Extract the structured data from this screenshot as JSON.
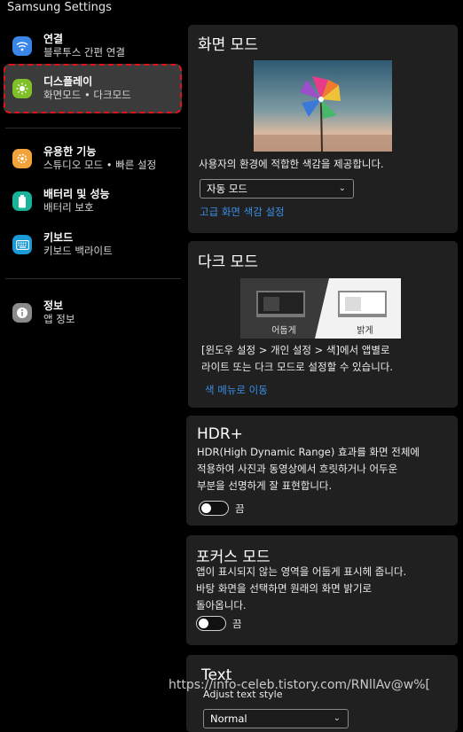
{
  "app": {
    "title": "Samsung Settings"
  },
  "sidebar": {
    "items": [
      {
        "title": "연결",
        "subtitle": "블루투스 간편 연결",
        "icon": "wifi-icon",
        "color": "#3a86e8"
      },
      {
        "title": "디스플레이",
        "subtitle": "화면모드 • 다크모드",
        "icon": "display-icon",
        "color": "#7fbf2a"
      },
      {
        "title": "유용한 기능",
        "subtitle": "스튜디오 모드 • 빠른 설정",
        "icon": "gear-badge-icon",
        "color": "#f2a23a"
      },
      {
        "title": "배터리 및 성능",
        "subtitle": "배터리 보호",
        "icon": "battery-icon",
        "color": "#19b39a"
      },
      {
        "title": "키보드",
        "subtitle": "키보드 백라이트",
        "icon": "keyboard-icon",
        "color": "#1a9ad6"
      },
      {
        "title": "정보",
        "subtitle": "앱 정보",
        "icon": "info-icon",
        "color": "#8a8a8a"
      }
    ],
    "active_border_color": "#e0121e"
  },
  "screen_mode": {
    "title": "화면 모드",
    "description": "사용자의 환경에 적합한 색감을 제공합니다.",
    "select_value": "자동 모드",
    "link": "고급 화면 색감 설정"
  },
  "dark_mode": {
    "title": "다크 모드",
    "option_dark": "어둡게",
    "option_light": "밝게",
    "description_line1": "[윈도우 설정 > 개인 설정 > 색]에서 앱별로",
    "description_line2": "라이트 또는 다크 모드로 설정할 수 있습니다.",
    "link": "색 메뉴로 이동"
  },
  "hdr": {
    "title": "HDR+",
    "line1": "HDR(High Dynamic Range) 효과를 화면 전체에",
    "line2": "적용하여 사진과 동영상에서 흐릿하거나 어두운",
    "line3": "부분을 선명하게 잘 표현합니다.",
    "toggle_state": "끔"
  },
  "focus": {
    "title": "포커스 모드",
    "line1": "앱이 표시되지 않는 영역을 어둡게 표시헤 줍니다.",
    "line2": "바탕 화면을 선택하면 원래의 화면 밝기로",
    "line3": "돌아옵니다.",
    "toggle_state": "끔"
  },
  "text": {
    "title": "Text",
    "subtitle": "Adjust text style",
    "select_value": "Normal"
  },
  "watermark": "https://info-celeb.tistory.com/RNllAv@w%["
}
